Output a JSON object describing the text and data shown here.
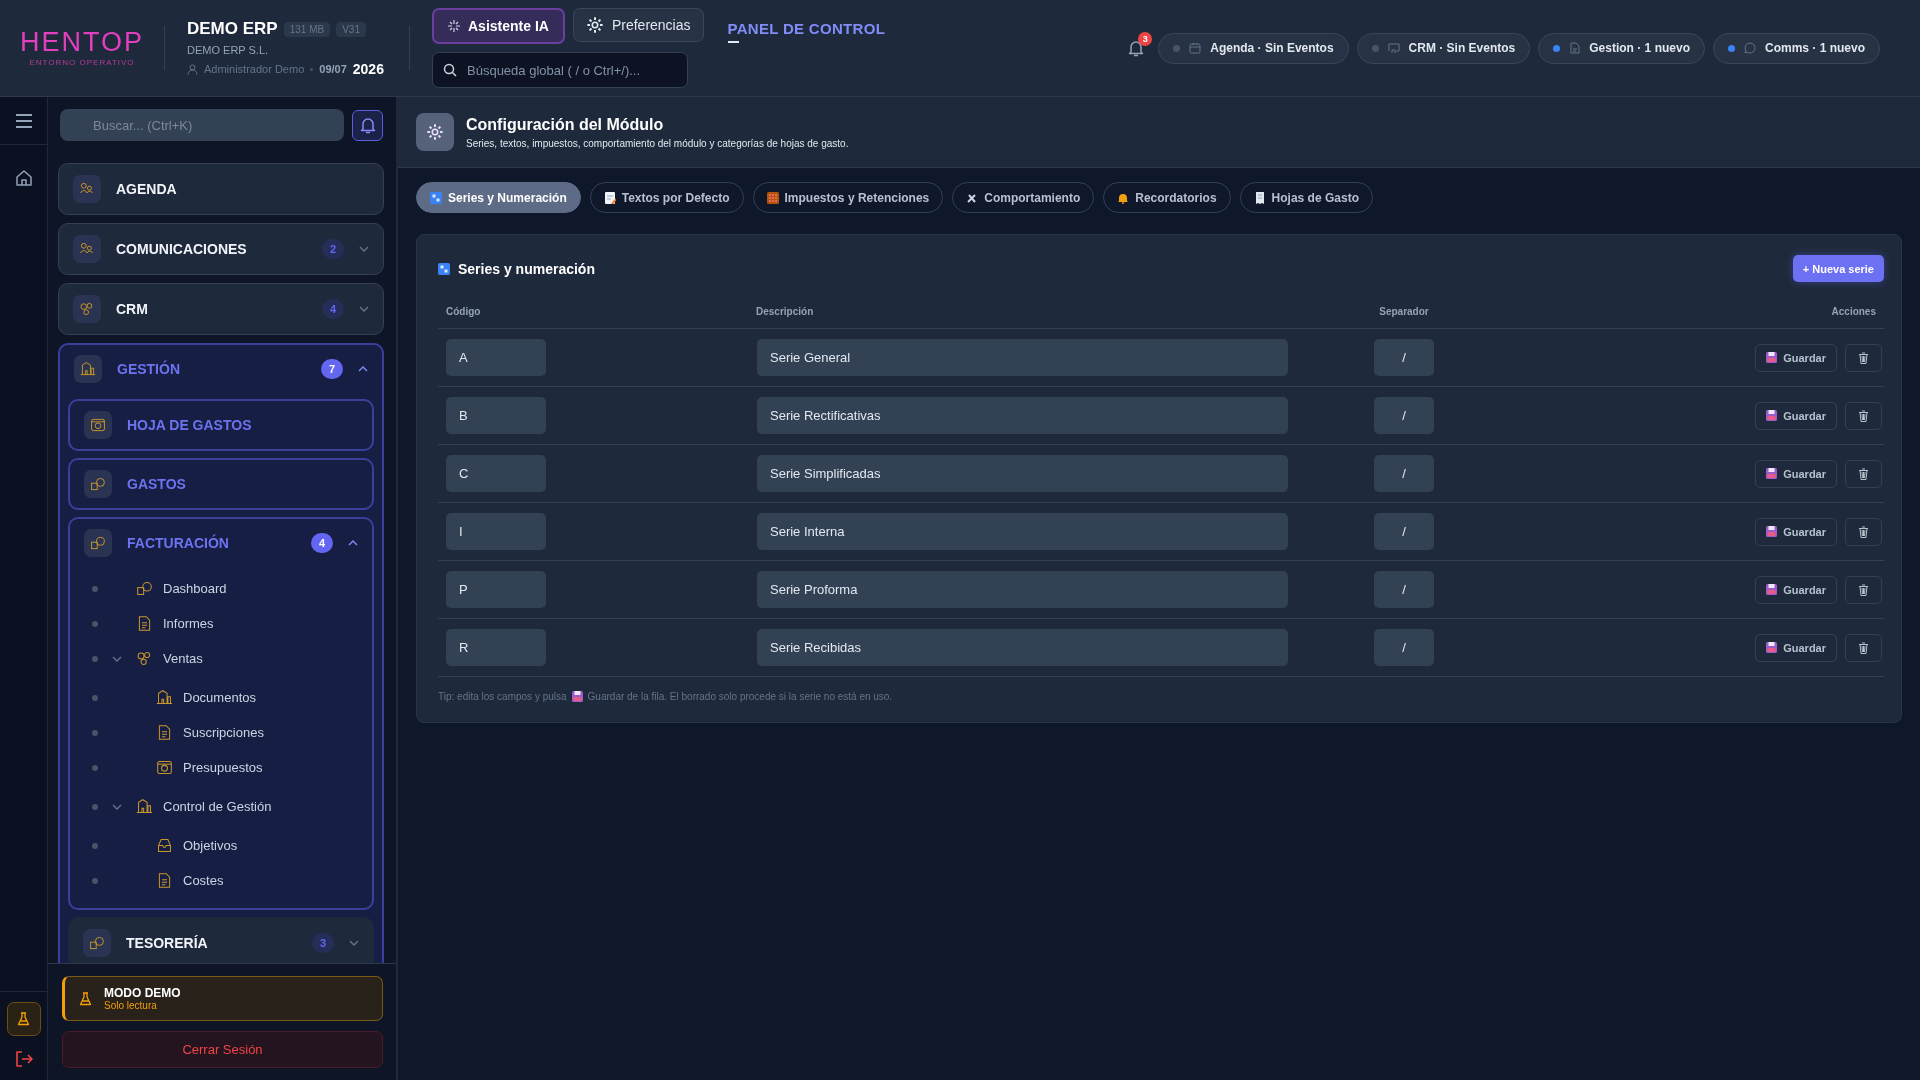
{
  "header": {
    "logo": {
      "name": "HENTOP",
      "tagline": "ENTORNO OPERATIVO"
    },
    "company": {
      "name": "DEMO ERP",
      "size": "131 MB",
      "version": "V31",
      "legal_name": "DEMO ERP S.L.",
      "user": "Administrador Demo",
      "date": "09/07",
      "year": "2026"
    },
    "assistant_button": "Asistente IA",
    "preferences_button": "Preferencias",
    "search": {
      "placeholder": "Búsqueda global ( / o Ctrl+/)..."
    },
    "section_title": "PANEL DE CONTROL",
    "notifications": {
      "count": "3"
    },
    "status_pills": [
      {
        "kind": "calendar",
        "label": "Agenda · Sin Eventos",
        "active": false
      },
      {
        "kind": "screen",
        "label": "CRM · Sin Eventos",
        "active": false
      },
      {
        "kind": "document",
        "label": "Gestion · 1 nuevo",
        "active": true
      },
      {
        "kind": "chat",
        "label": "Comms · 1 nuevo",
        "active": true
      }
    ]
  },
  "sidebar": {
    "search": {
      "placeholder": "Buscar... (Ctrl+K)"
    },
    "menu": [
      {
        "kind": "link",
        "label": "AGENDA",
        "active": false
      },
      {
        "kind": "group",
        "label": "COMUNICACIONES",
        "badge": "2",
        "expanded": false,
        "active": false
      },
      {
        "kind": "group",
        "label": "CRM",
        "badge": "4",
        "expanded": false,
        "active": false
      },
      {
        "kind": "group",
        "label": "GESTIÓN",
        "badge": "7",
        "expanded": true,
        "active": true,
        "children": [
          {
            "kind": "link",
            "label": "HOJA DE GASTOS",
            "active": true
          },
          {
            "kind": "link",
            "label": "GASTOS",
            "active": true
          },
          {
            "kind": "group",
            "label": "FACTURACIÓN",
            "badge": "4",
            "expanded": true,
            "active": true,
            "children": [
              {
                "label": "Dashboard"
              },
              {
                "label": "Informes"
              },
              {
                "label": "Ventas",
                "expanded": true,
                "children": [
                  {
                    "label": "Documentos"
                  },
                  {
                    "label": "Suscripciones"
                  },
                  {
                    "label": "Presupuestos"
                  }
                ]
              },
              {
                "label": "Control de Gestión",
                "expanded": true,
                "children": [
                  {
                    "label": "Objetivos"
                  },
                  {
                    "label": "Costes"
                  }
                ]
              }
            ]
          },
          {
            "kind": "group",
            "label": "TESORERÍA",
            "badge": "3",
            "expanded": false,
            "active": false
          }
        ]
      }
    ],
    "demo_mode": {
      "title": "MODO DEMO",
      "subtitle": "Solo lectura"
    },
    "logout_button": "Cerrar Sesión"
  },
  "page": {
    "title": "Configuración del Módulo",
    "subtitle": "Series, textos, impuestos, comportamiento del módulo y categorías de hojas de gasto.",
    "tabs": [
      {
        "label": "Series y Numeración",
        "selected": true
      },
      {
        "label": "Textos por Defecto",
        "selected": false
      },
      {
        "label": "Impuestos y Retenciones",
        "selected": false
      },
      {
        "label": "Comportamiento",
        "selected": false
      },
      {
        "label": "Recordatorios",
        "selected": false
      },
      {
        "label": "Hojas de Gasto",
        "selected": false
      }
    ],
    "card": {
      "title": "Series y numeración",
      "new_button": "+ Nueva serie",
      "columns": [
        "Código",
        "Descripción",
        "Separador",
        "Acciones"
      ],
      "rows": [
        {
          "code": "A",
          "description": "Serie General",
          "separator": "/",
          "save_button": "Guardar"
        },
        {
          "code": "B",
          "description": "Serie Rectificativas",
          "separator": "/",
          "save_button": "Guardar"
        },
        {
          "code": "C",
          "description": "Serie Simplificadas",
          "separator": "/",
          "save_button": "Guardar"
        },
        {
          "code": "I",
          "description": "Serie Interna",
          "separator": "/",
          "save_button": "Guardar"
        },
        {
          "code": "P",
          "description": "Serie Proforma",
          "separator": "/",
          "save_button": "Guardar"
        },
        {
          "code": "R",
          "description": "Serie Recibidas",
          "separator": "/",
          "save_button": "Guardar"
        }
      ],
      "tip": {
        "before": "Tip: edita los campos y pulsa",
        "after": "Guardar de la fila. El borrado solo procede si la serie no está en uso."
      }
    }
  }
}
